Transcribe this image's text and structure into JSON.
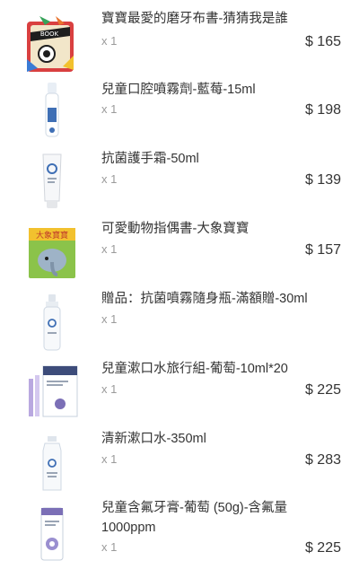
{
  "order_items": [
    {
      "name": "寶寶最愛的磨牙布書-猜猜我是誰",
      "qty": "x 1",
      "price": "$ 165",
      "thumb_icon": "cloth-book-icon"
    },
    {
      "name": "兒童口腔噴霧劑-藍莓-15ml",
      "qty": "x 1",
      "price": "$ 198",
      "thumb_icon": "spray-bottle-icon"
    },
    {
      "name": "抗菌護手霜-50ml",
      "qty": "x 1",
      "price": "$ 139",
      "thumb_icon": "cream-tube-icon"
    },
    {
      "name": "可愛動物指偶書-大象寶寶",
      "qty": "x 1",
      "price": "$ 157",
      "thumb_icon": "finger-puppet-book-icon",
      "thumb_text": "大象寶寶"
    },
    {
      "name": "贈品：抗菌噴霧隨身瓶-滿額贈-30ml",
      "qty": "x 1",
      "price": "",
      "thumb_icon": "pump-bottle-icon"
    },
    {
      "name": "兒童漱口水旅行組-葡萄-10ml*20",
      "qty": "x 1",
      "price": "$ 225",
      "thumb_icon": "mouthwash-box-icon"
    },
    {
      "name": "清新漱口水-350ml",
      "qty": "x 1",
      "price": "$ 283",
      "thumb_icon": "mouthwash-bottle-icon"
    },
    {
      "name": "兒童含氟牙膏-葡萄 (50g)-含氟量1000ppm",
      "qty": "x 1",
      "price": "$ 225",
      "thumb_icon": "toothpaste-icon"
    }
  ]
}
